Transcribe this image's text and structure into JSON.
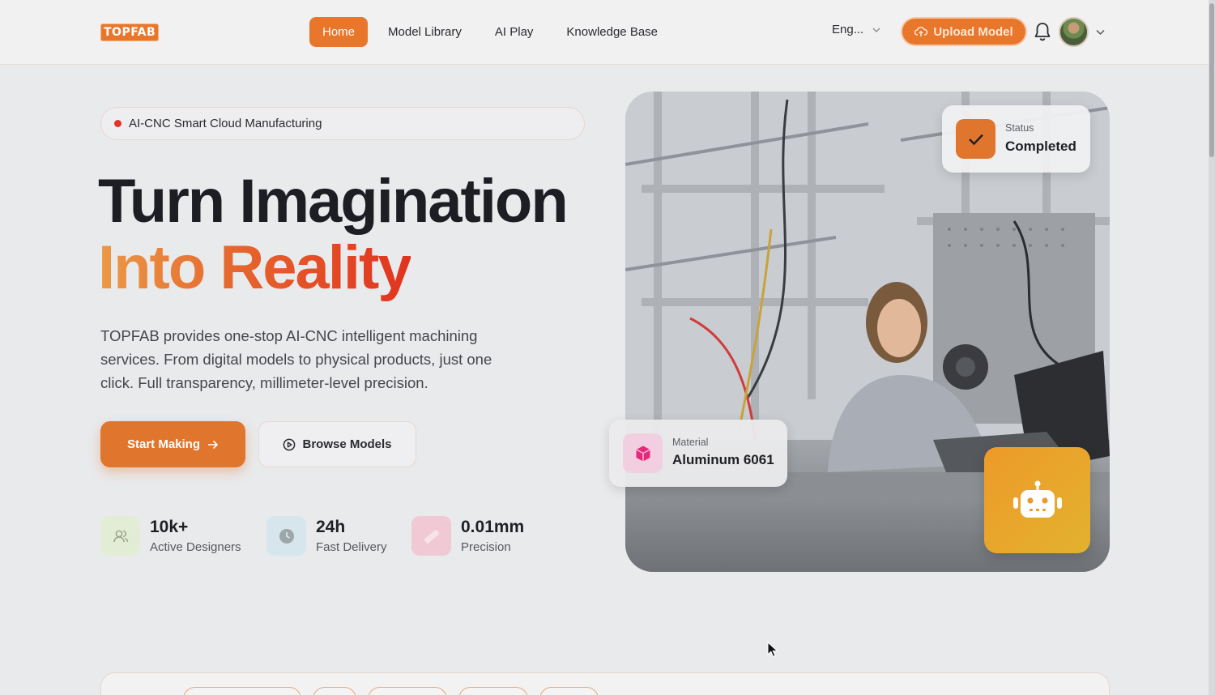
{
  "header": {
    "logo": "TOPFAB",
    "nav": [
      {
        "label": "Home",
        "active": true
      },
      {
        "label": "Model Library",
        "active": false
      },
      {
        "label": "AI Play",
        "active": false
      },
      {
        "label": "Knowledge Base",
        "active": false
      }
    ],
    "language": "Eng...",
    "upload_label": "Upload Model"
  },
  "hero": {
    "badge": "AI-CNC Smart Cloud Manufacturing",
    "title_line1": "Turn Imagination",
    "title_line2": "Into Reality",
    "description": "TOPFAB provides one-stop AI-CNC intelligent machining services. From digital models to physical products, just one click. Full transparency, millimeter-level precision.",
    "primary_button": "Start Making",
    "secondary_button": "Browse Models",
    "stats": [
      {
        "value": "10k+",
        "label": "Active Designers",
        "icon": "users-icon",
        "color": "#e3edd6"
      },
      {
        "value": "24h",
        "label": "Fast Delivery",
        "icon": "clock-icon",
        "color": "#d7e6ec"
      },
      {
        "value": "0.01mm",
        "label": "Precision",
        "icon": "ruler-icon",
        "color": "#f1c9d5"
      }
    ]
  },
  "status_card": {
    "label": "Status",
    "value": "Completed"
  },
  "material_card": {
    "label": "Material",
    "value": "Aluminum 6061"
  },
  "colors": {
    "accent": "#e8772c",
    "title_gradient_end": "#e1331f",
    "robot_button": "#ee9a2a"
  }
}
